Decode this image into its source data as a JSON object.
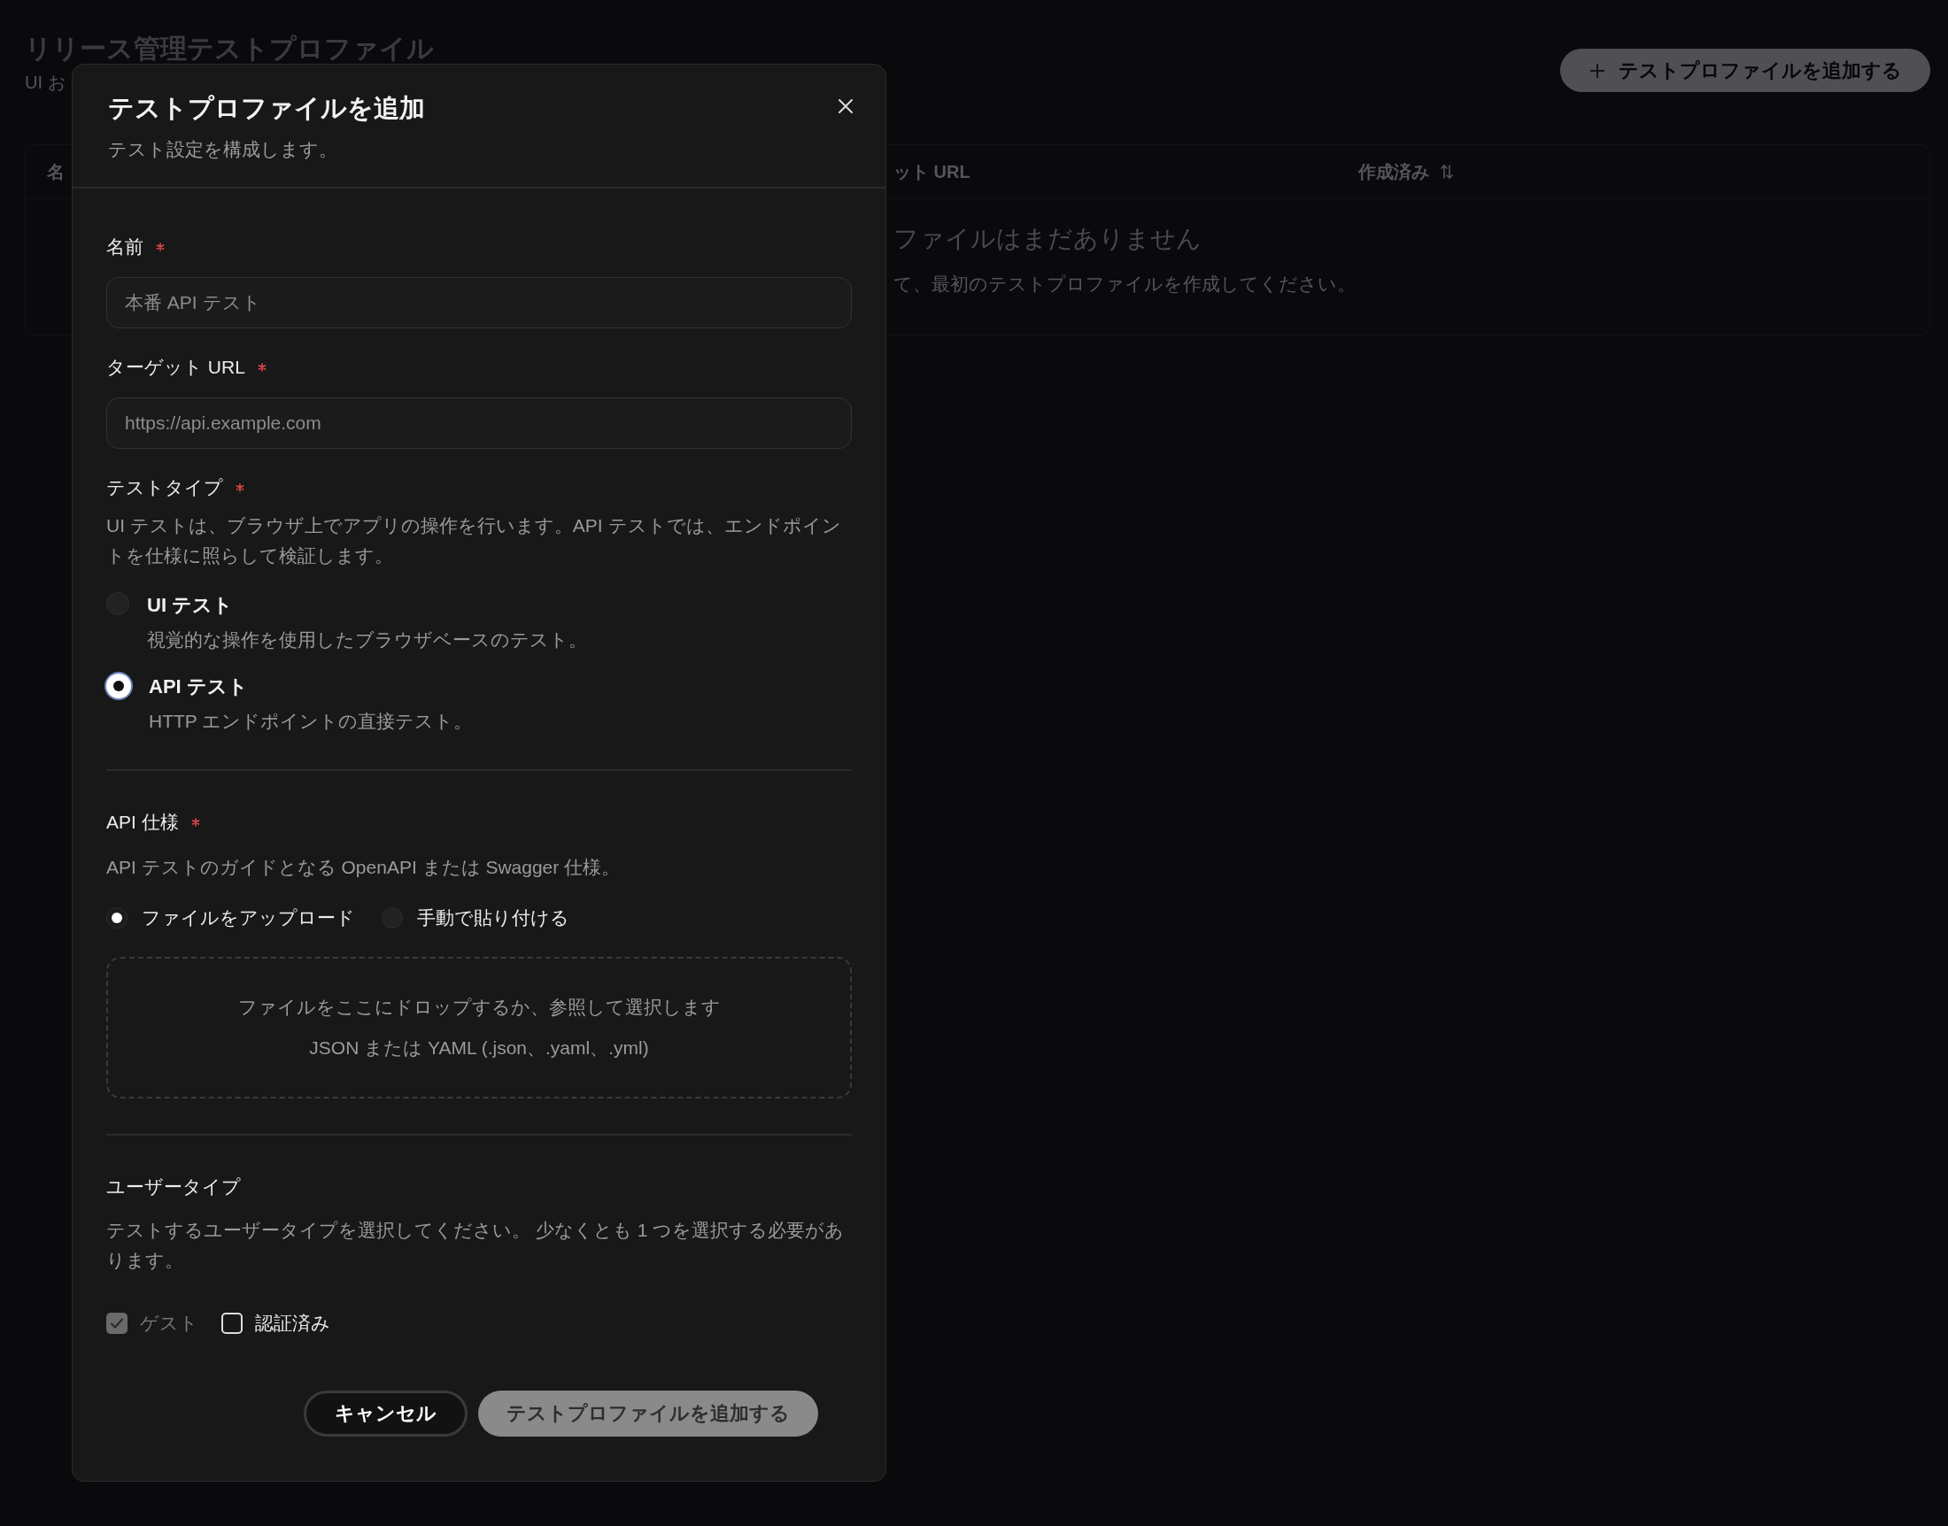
{
  "page": {
    "title": "リリース管理テストプロファイル",
    "subtitle": "UI お",
    "add_button": "テストプロファイルを追加する"
  },
  "table": {
    "columns": [
      {
        "label": "名"
      },
      {
        "label": "ット URL"
      },
      {
        "label": "作成済み",
        "sortable": true
      }
    ],
    "empty_title": "ファイルはまだありません",
    "empty_message": "て、最初のテストプロファイルを作成してください。"
  },
  "dialog": {
    "title": "テストプロファイルを追加",
    "subtitle": "テスト設定を構成します。",
    "sections": [
      {
        "kind": "text",
        "label": "名前",
        "required": true,
        "divider_before": false,
        "placeholder": "本番 API テスト"
      },
      {
        "kind": "text",
        "label": "ターゲット URL",
        "required": true,
        "divider_before": false,
        "placeholder": "https://api.example.com"
      },
      {
        "kind": "radio-cards",
        "label": "テストタイプ",
        "required": true,
        "divider_before": false,
        "description": "UI テストは、ブラウザ上でアプリの操作を行います。API テストでは、エンドポイントを仕様に照らして検証します。",
        "options": [
          {
            "label": "UI テスト",
            "description": "視覚的な操作を使用したブラウザベースのテスト。",
            "selected": false
          },
          {
            "label": "API テスト",
            "description": "HTTP エンドポイントの直接テスト。",
            "selected": true
          }
        ]
      },
      {
        "kind": "spec",
        "label": "API 仕様",
        "required": true,
        "divider_before": true,
        "description": "API テストのガイドとなる OpenAPI または Swagger 仕様。",
        "options": [
          {
            "label": "ファイルをアップロード",
            "selected": true
          },
          {
            "label": "手動で貼り付ける",
            "selected": false
          }
        ],
        "dropzone": [
          "ファイルをここにドロップするか、参照して選択します",
          "JSON または YAML (.json、.yaml、.yml)"
        ]
      },
      {
        "kind": "checkboxes",
        "label": "ユーザータイプ",
        "required": false,
        "divider_before": true,
        "description": "テストするユーザータイプを選択してください。 少なくとも 1 つを選択する必要があります。",
        "options": [
          {
            "label": "ゲスト",
            "checked": true,
            "disabled": true
          },
          {
            "label": "認証済み",
            "checked": false,
            "disabled": false
          }
        ]
      }
    ],
    "buttons": [
      {
        "label": "キャンセル",
        "kind": "secondary",
        "disabled": false
      },
      {
        "label": "テストプロファイルを追加する",
        "kind": "primary",
        "disabled": true
      }
    ]
  }
}
